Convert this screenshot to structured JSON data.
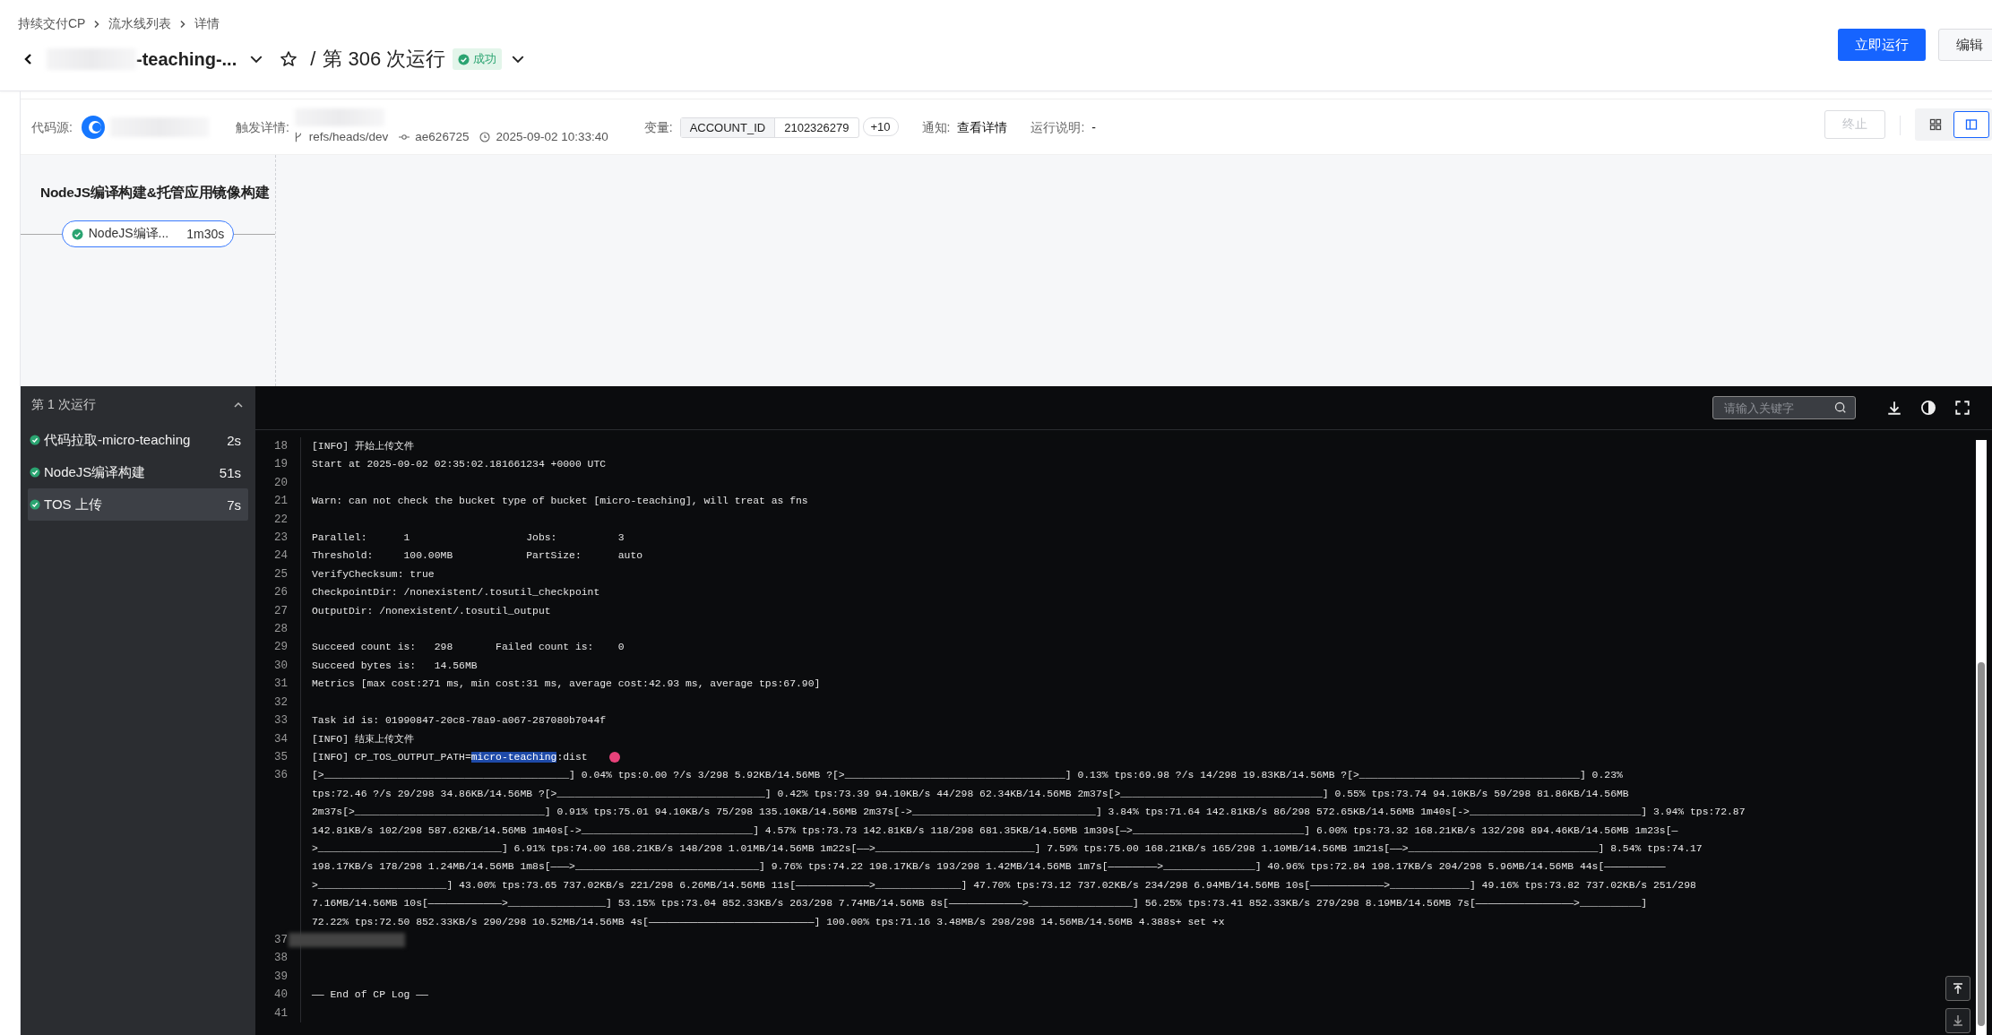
{
  "breadcrumb": [
    {
      "label": "持续交付CP"
    },
    {
      "label": "流水线列表"
    },
    {
      "label": "详情"
    }
  ],
  "title": {
    "name": "-teaching-...",
    "separator": "/",
    "run": "第 306 次运行",
    "status": "成功",
    "starred": false
  },
  "actions": [
    {
      "label": "立即运行",
      "kind": "primary"
    },
    {
      "label": "编辑",
      "kind": "default"
    }
  ],
  "info": {
    "source_label": "代码源:",
    "trigger_label": "触发详情:",
    "branch": "refs/heads/dev",
    "commit": "ae626725",
    "time": "2025-09-02 10:33:40",
    "variables_label": "变量:",
    "variable_key": "ACCOUNT_ID",
    "variable_value": "2102326279",
    "more_variables": "+10",
    "notify_label": "通知:",
    "notify_link": "查看详情",
    "note_label": "运行说明:",
    "note": "-",
    "stop_button": {
      "label": "终止",
      "disabled": true
    },
    "views": [
      {
        "kind": "grid",
        "selected": false
      },
      {
        "kind": "columns",
        "selected": true
      }
    ]
  },
  "stage": {
    "title": "NodeJS编译构建&托管应用镜像构建",
    "jobs": [
      {
        "name": "NodeJS编译...",
        "duration": "1m30s"
      }
    ]
  },
  "run_panel": {
    "title": "第 1 次运行",
    "expanded": true,
    "steps": [
      {
        "name": "代码拉取-micro-teaching",
        "duration": "2s",
        "selected": false
      },
      {
        "name": "NodeJS编译构建",
        "duration": "51s",
        "selected": false
      },
      {
        "name": "TOS 上传",
        "duration": "7s",
        "selected": true
      }
    ]
  },
  "log": {
    "search_placeholder": "请输入关键字",
    "lines": [
      {
        "n": "18",
        "text": "[INFO] 开始上传文件"
      },
      {
        "n": "19",
        "text": "Start at 2025-09-02 02:35:02.181661234 +0000 UTC"
      },
      {
        "n": "20"
      },
      {
        "n": "21",
        "text": "Warn: can not check the bucket type of bucket [micro-teaching], will treat as fns"
      },
      {
        "n": "22"
      },
      {
        "n": "23",
        "text": "Parallel:      1                   Jobs:          3"
      },
      {
        "n": "24",
        "text": "Threshold:     100.00MB            PartSize:      auto"
      },
      {
        "n": "25",
        "text": "VerifyChecksum: true"
      },
      {
        "n": "26",
        "text": "CheckpointDir: /nonexistent/.tosutil_checkpoint"
      },
      {
        "n": "27",
        "text": "OutputDir: /nonexistent/.tosutil_output"
      },
      {
        "n": "28"
      },
      {
        "n": "29",
        "text": "Succeed count is:   298       Failed count is:    0"
      },
      {
        "n": "30",
        "text": "Succeed bytes is:   14.56MB"
      },
      {
        "n": "31",
        "text": "Metrics [max cost:271 ms, min cost:31 ms, average cost:42.93 ms, average tps:67.90]"
      },
      {
        "n": "32"
      },
      {
        "n": "33",
        "text": "Task id is: 01990847-20c8-78a9-a067-287080b7044f"
      },
      {
        "n": "34",
        "text": "[INFO] 结束上传文件"
      },
      {
        "n": "35",
        "parts": [
          {
            "text": "[INFO] CP_TOS_OUTPUT_PATH=",
            "highlighted": false
          },
          {
            "text": "micro-teaching",
            "highlighted": true
          },
          {
            "text": ":dist",
            "highlighted": false
          }
        ]
      },
      {
        "n": "36",
        "rows": [
          "[>________________________________________] 0.04% tps:0.00 ?/s 3/298 5.92KB/14.56MB ?[>____________________________________] 0.13% tps:69.98 ?/s 14/298 19.83KB/14.56MB ?[>____________________________________] 0.23%",
          "tps:72.46 ?/s 29/298 34.86KB/14.56MB ?[>__________________________________] 0.42% tps:73.39 94.10KB/s 44/298 62.34KB/14.56MB 2m37s[>_________________________________] 0.55% tps:73.74 94.10KB/s 59/298 81.86KB/14.56MB",
          "2m37s[>_______________________________] 0.91% tps:75.01 94.10KB/s 75/298 135.10KB/14.56MB 2m37s[->______________________________] 3.84% tps:71.64 142.81KB/s 86/298 572.65KB/14.56MB 1m40s[->____________________________] 3.94% tps:72.87",
          "142.81KB/s 102/298 587.62KB/14.56MB 1m40s[->____________________________] 4.57% tps:73.73 142.81KB/s 118/298 681.35KB/14.56MB 1m39s[—>____________________________] 6.00% tps:73.32 168.21KB/s 132/298 894.46KB/14.56MB 1m23s[—",
          ">______________________________] 6.91% tps:74.00 168.21KB/s 148/298 1.01MB/14.56MB 1m22s[——>__________________________] 7.59% tps:75.00 168.21KB/s 165/298 1.10MB/14.56MB 1m21s[——>_______________________________] 8.54% tps:74.17",
          "198.17KB/s 178/298 1.24MB/14.56MB 1m8s[———>______________________________] 9.76% tps:74.22 198.17KB/s 193/298 1.42MB/14.56MB 1m7s[————————>_______________] 40.96% tps:72.84 198.17KB/s 204/298 5.96MB/14.56MB 44s[——————————",
          ">_____________________] 43.00% tps:73.65 737.02KB/s 221/298 6.26MB/14.56MB 11s[————————————>______________] 47.70% tps:73.12 737.02KB/s 234/298 6.94MB/14.56MB 10s[————————————>_____________] 49.16% tps:73.82 737.02KB/s 251/298",
          "7.16MB/14.56MB 10s[————————————>________________] 53.15% tps:73.04 852.33KB/s 263/298 7.74MB/14.56MB 8s[————————————>_________________] 56.25% tps:73.41 852.33KB/s 279/298 8.19MB/14.56MB 7s[————————————————>__________]",
          "72.22% tps:72.50 852.33KB/s 290/298 10.52MB/14.56MB 4s[———————————————————————————] 100.00% tps:71.16 3.48MB/s 298/298 14.56MB/14.56MB 4.388s+ set +x"
        ]
      },
      {
        "n": "37",
        "redacted": true
      },
      {
        "n": "38"
      },
      {
        "n": "39"
      },
      {
        "n": "40",
        "text": "—— End of CP Log ——"
      },
      {
        "n": "41"
      }
    ]
  }
}
